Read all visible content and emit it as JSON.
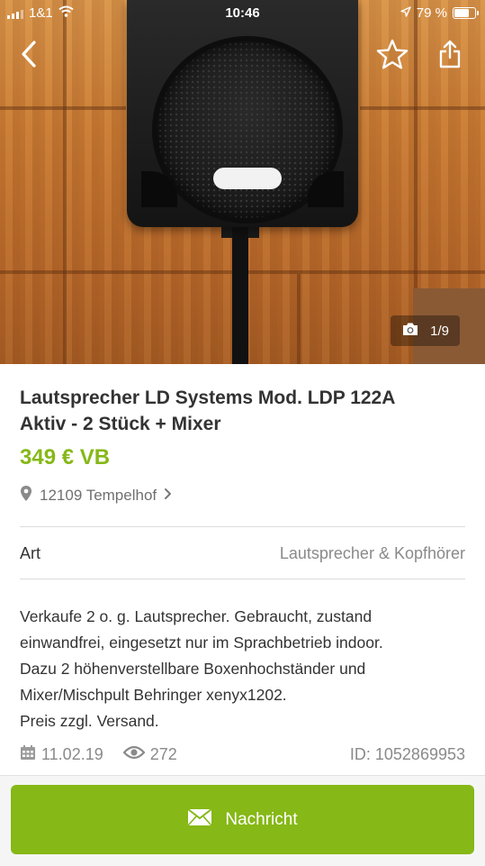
{
  "status_bar": {
    "carrier": "1&1",
    "time": "10:46",
    "battery_percent": "79 %",
    "battery_level": 0.79,
    "icons": [
      "signal-icon",
      "wifi-icon",
      "location-arrow-icon",
      "battery-icon"
    ]
  },
  "header": {
    "icons": [
      "back-chevron-icon",
      "star-outline-icon",
      "share-icon"
    ]
  },
  "gallery": {
    "counter": "1/9",
    "icon": "camera-icon"
  },
  "listing": {
    "title": "Lautsprecher LD Systems  Mod. LDP 122A Aktiv - 2 Stück + Mixer",
    "price": "349 € VB",
    "location": "12109 Tempelhof",
    "attribute_label": "Art",
    "attribute_value": "Lautsprecher & Kopfhörer",
    "description_lines": [
      "Verkaufe 2 o. g. Lautsprecher. Gebraucht, zustand",
      "einwandfrei, eingesetzt nur im Sprachbetrieb indoor.",
      "Dazu 2 höhenverstellbare Boxenhochständer und",
      "Mixer/Mischpult Behringer xenyx1202.",
      "Preis zzgl. Versand."
    ],
    "date": "11.02.19",
    "views": "272",
    "id": "ID: 1052869953"
  },
  "action": {
    "message_label": "Nachricht",
    "icon": "envelope-icon"
  },
  "colors": {
    "accent_green": "#86b817",
    "text_dark": "#333333",
    "text_muted": "#8a8a8a"
  }
}
